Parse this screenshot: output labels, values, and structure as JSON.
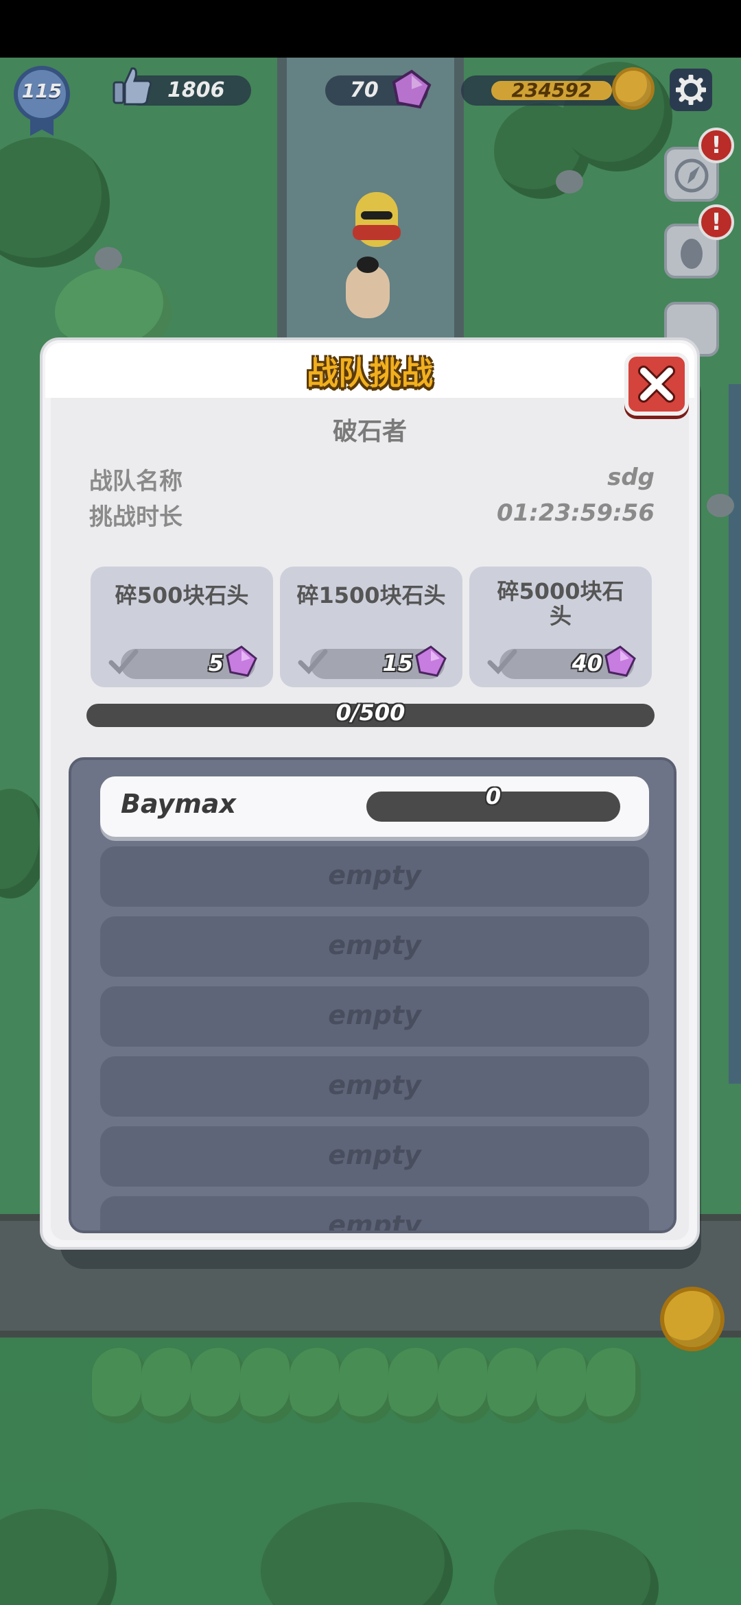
{
  "hud": {
    "level": "115",
    "likes": "1806",
    "gems": "70",
    "coins": "234592",
    "side_alerts": [
      "!",
      "!"
    ]
  },
  "dialog": {
    "title": "战队挑战",
    "team_title": "破石者",
    "team_name_label": "战队名称",
    "team_name_value": "sdg",
    "duration_label": "挑战时长",
    "duration_value": "01:23:59:56",
    "goals": [
      {
        "text": "碎500块石头",
        "reward": "5"
      },
      {
        "text": "碎1500块石头",
        "reward": "15"
      },
      {
        "text": "碎5000块石",
        "text2": "头",
        "reward": "40"
      }
    ],
    "progress": {
      "text": "0/500",
      "fraction": 0
    },
    "members": [
      {
        "name": "Baymax",
        "score": "0"
      },
      {
        "empty": "empty"
      },
      {
        "empty": "empty"
      },
      {
        "empty": "empty"
      },
      {
        "empty": "empty"
      },
      {
        "empty": "empty"
      },
      {
        "empty": "empty"
      }
    ]
  },
  "colors": {
    "title_gold": "#f2b01f",
    "close_red": "#d4433c",
    "gem_purple": "#c77ce0",
    "panel_slate": "#6e7487"
  },
  "icons": [
    "thumbs-up-icon",
    "gem-icon",
    "coin-icon",
    "gear-icon",
    "close-icon",
    "check-icon",
    "alert-icon"
  ]
}
